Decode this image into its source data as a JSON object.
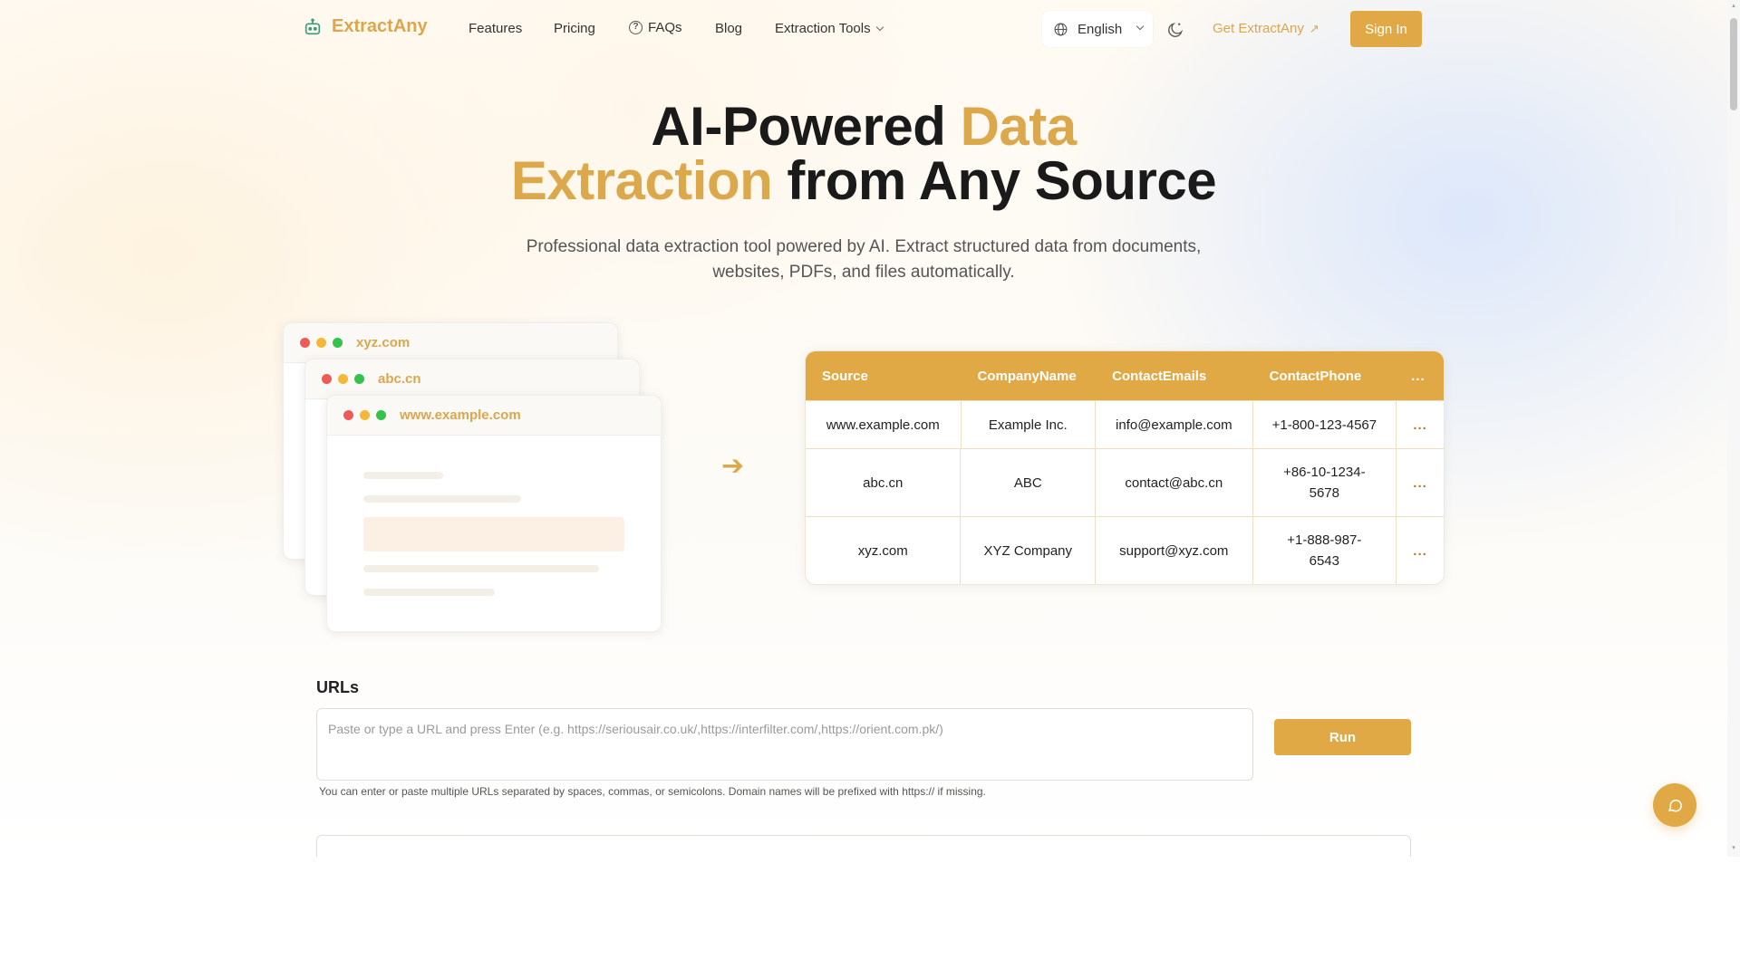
{
  "nav": {
    "brand": "ExtractAny",
    "links": [
      "Features",
      "Pricing",
      "FAQs",
      "Blog",
      "Extraction Tools"
    ],
    "language": "English",
    "get_label": "Get ExtractAny",
    "signin_label": "Sign In"
  },
  "hero": {
    "title_line1_a": "AI-Powered ",
    "title_line1_b": "Data",
    "title_line2_a": "Extraction",
    "title_line2_b": " from Any Source",
    "subtitle": "Professional data extraction tool powered by AI. Extract structured data from documents, websites, PDFs, and files automatically."
  },
  "illustration": {
    "browsers": [
      "xyz.com",
      "abc.cn",
      "www.example.com"
    ],
    "arrow": "➔"
  },
  "table": {
    "headers": [
      "Source",
      "CompanyName",
      "ContactEmails",
      "ContactPhone",
      "..."
    ],
    "rows": [
      [
        "www.example.com",
        "Example Inc.",
        "info@example.com",
        "+1-800-123-4567",
        "..."
      ],
      [
        "abc.cn",
        "ABC",
        "contact@abc.cn",
        "+86-10-1234-5678",
        "..."
      ],
      [
        "xyz.com",
        "XYZ Company",
        "support@xyz.com",
        "+1-888-987-6543",
        "..."
      ]
    ]
  },
  "urls": {
    "label": "URLs",
    "placeholder": "Paste or type a URL and press Enter (e.g. https://seriousair.co.uk/,https://interfilter.com/,https://orient.com.pk/)",
    "run_label": "Run",
    "hint": "You can enter or paste multiple URLs separated by spaces, commas, or semicolons. Domain names will be prefixed with https:// if missing."
  },
  "colors": {
    "accent": "#e0a945",
    "brand_text": "#dba64c"
  }
}
